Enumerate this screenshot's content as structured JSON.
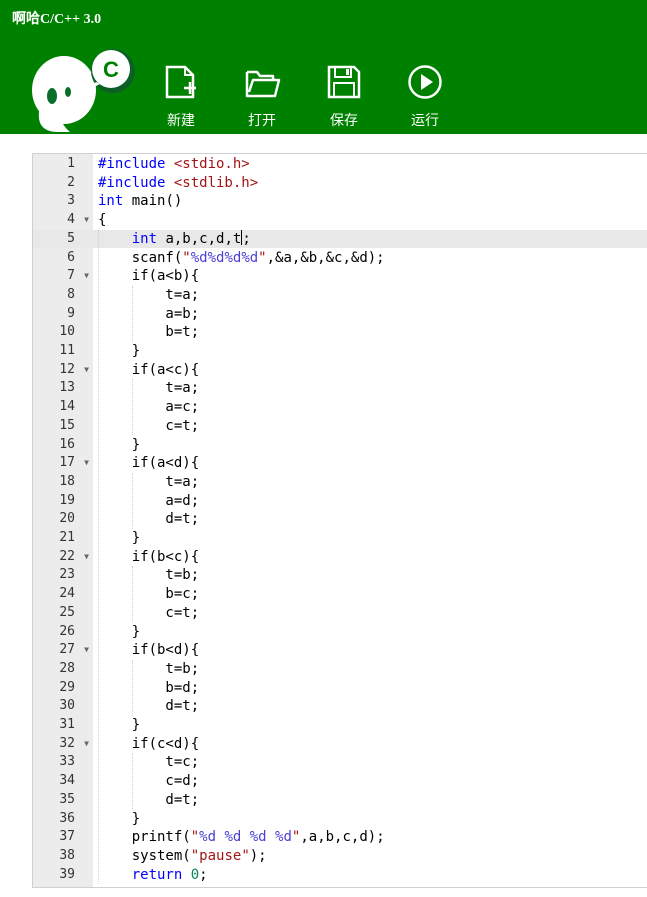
{
  "app": {
    "title": "啊哈C/C++ 3.0",
    "mascot_letter": "C"
  },
  "toolbar": [
    {
      "id": "new",
      "label": "新建",
      "icon": "new-file-icon"
    },
    {
      "id": "open",
      "label": "打开",
      "icon": "folder-open-icon"
    },
    {
      "id": "save",
      "label": "保存",
      "icon": "save-icon"
    },
    {
      "id": "run",
      "label": "运行",
      "icon": "play-icon"
    }
  ],
  "colors": {
    "header": "#008000",
    "gutter": "#ececec",
    "active_line": "#e8e8e8"
  },
  "editor": {
    "active_line": 5,
    "fold_lines": [
      4,
      7,
      12,
      17,
      22,
      27,
      32
    ],
    "lines": [
      "#include <stdio.h>",
      "#include <stdlib.h>",
      "int main()",
      "{",
      "    int a,b,c,d,t;",
      "    scanf(\"%d%d%d%d\",&a,&b,&c,&d);",
      "    if(a<b){",
      "        t=a;",
      "        a=b;",
      "        b=t;",
      "    }",
      "    if(a<c){",
      "        t=a;",
      "        a=c;",
      "        c=t;",
      "    }",
      "    if(a<d){",
      "        t=a;",
      "        a=d;",
      "        d=t;",
      "    }",
      "    if(b<c){",
      "        t=b;",
      "        b=c;",
      "        c=t;",
      "    }",
      "    if(b<d){",
      "        t=b;",
      "        b=d;",
      "        d=t;",
      "    }",
      "    if(c<d){",
      "        t=c;",
      "        c=d;",
      "        d=t;",
      "    }",
      "    printf(\"%d %d %d %d\",a,b,c,d);",
      "    system(\"pause\");",
      "    return 0;"
    ]
  }
}
